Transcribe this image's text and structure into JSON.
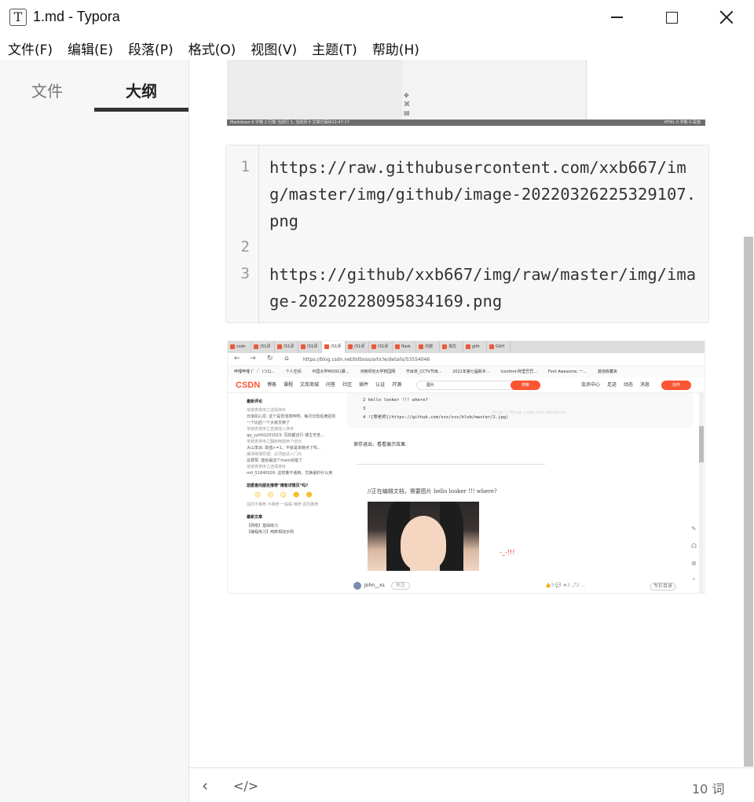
{
  "window": {
    "app_icon": "T",
    "title": "1.md - Typora"
  },
  "menu": {
    "items": [
      "文件(F)",
      "编辑(E)",
      "段落(P)",
      "格式(O)",
      "视图(V)",
      "主题(T)",
      "帮助(H)"
    ]
  },
  "sidebar": {
    "tabs": [
      {
        "label": "文件"
      },
      {
        "label": "大纲"
      }
    ]
  },
  "image1": {
    "status_left": "Markdown  0 字数  2 行数  当前行 1, 当前列 0  文章已保存22:47:17",
    "status_right": "HTML  0 字数  0 段落"
  },
  "code": {
    "lines": [
      {
        "num": "1",
        "text": "https://raw.githubusercontent.com/xxb667/img/master/img/github/image-20220326225329107.png"
      },
      {
        "num": "2",
        "text": ""
      },
      {
        "num": "3",
        "text": "https://github/xxb667/img/raw/master/img/image-20220228095834169.png"
      }
    ]
  },
  "image2": {
    "tabs": [
      "csdn",
      "(51评",
      "(51评",
      "(51评",
      "(51评",
      "(51评",
      "(51评",
      "flask",
      "内部",
      "淘文",
      "gith",
      "GitH"
    ],
    "url": "https://blog.csdn.net/bitboss/article/details/53554046",
    "bookmarks": [
      "哔哩哔哩 (゜-゜)つロ...",
      "个人空间",
      "中国大学MOOC(慕...",
      "河南师范大学校园网",
      "节目单_CCTV节目...",
      "2021年第七届新乡...",
      "iconfont-阿里巴巴...",
      "Font Awesome, 一...",
      "其他收藏夹"
    ],
    "logo": "CSDN",
    "nav_links": [
      "博客",
      "课程",
      "文库商城",
      "问答",
      "社区",
      "插件",
      "认证",
      "开源"
    ],
    "search_placeholder": "图片",
    "search_button": "搜索",
    "right_links": [
      "会员中心",
      "足迹",
      "动态",
      "消息"
    ],
    "create_button": "创作",
    "left_panel": {
      "comments_title": "最新评论",
      "comments": [
        {
          "sub": "单链表排序之选择排序",
          "text": "日渐扣心龙: 这个是冒泡排序吧，每次比较后满足的一个比后一个大就交换了"
        },
        {
          "sub": "单链表排序之直接插入排序",
          "text": "qq_yytt01201023: 写的都还行 博主辛苦..."
        },
        {
          "sub": "单链表排序之翻转两数两个结点",
          "text": "大山李派: 取值>=1，不就是单链点了吗..."
        },
        {
          "sub": "编译链接原理：必须面试入门点",
          "text": "总督赞: 能给最这个main出错了"
        },
        {
          "sub": "单链表排序之选择排序",
          "text": "m0_51840026: 这样推不通用，交换最料什么用"
        }
      ],
      "recommend_title": "您愿意向朋友推荐\"博客详情页\"吗?",
      "ratings": "强烈不推荐  不推荐  一般般  推荐  强烈推荐",
      "articles_title": "最新文章",
      "articles": [
        "【网络】基础练习",
        "【编程练习】两数相加示例"
      ]
    },
    "code_lines": [
      "2  hello looker !!!   where?",
      "3",
      "4  ![零老师](https://github.com/xxx/xxx/blob/master/2.jpg)"
    ],
    "watermark": "http://blog.csdn.net/bitboss",
    "para": "保存退出，看看展示效果:",
    "inner_text": "//正在编辑文档，需要图片 hello looker !!! where?",
    "red_note": "-_-!!!",
    "author": "John__xs",
    "follow": "关注",
    "stats": "👍3  💬  ★3  ⤴2  ...",
    "column": "专栏目录"
  },
  "footer": {
    "back_glyph": "‹",
    "source_glyph": "</>",
    "word_count": "10 词"
  }
}
